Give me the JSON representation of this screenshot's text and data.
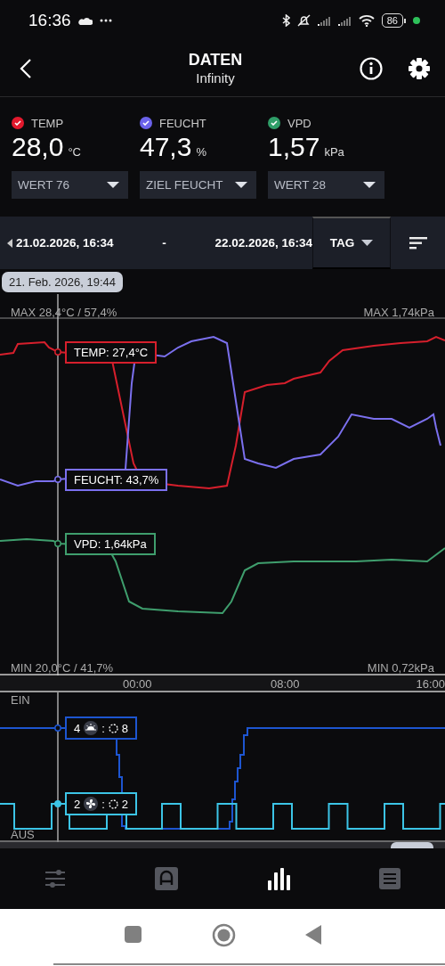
{
  "status_bar": {
    "time": "16:36",
    "battery": "86"
  },
  "header": {
    "title": "DATEN",
    "subtitle": "Infinity"
  },
  "sensors": [
    {
      "label": "TEMP",
      "value": "28,0",
      "unit": "°C",
      "color": "#e3192d",
      "checked": true,
      "dropdown": "WERT 76"
    },
    {
      "label": "FEUCHT",
      "value": "47,3",
      "unit": "%",
      "color": "#6b62ea",
      "checked": true,
      "dropdown": "ZIEL FEUCHT"
    },
    {
      "label": "VPD",
      "value": "1,57",
      "unit": "kPa",
      "color": "#2f9e68",
      "checked": true,
      "dropdown": "WERT 28"
    }
  ],
  "date_range": {
    "start": "21.02.2026, 16:34",
    "separator": "-",
    "end": "22.02.2026, 16:34",
    "period": "TAG"
  },
  "cursor": {
    "time": "21. Feb. 2026, 19:44"
  },
  "chart": {
    "max_left": "MAX 28,4°C / 57,4%",
    "max_right": "MAX 1,74kPa",
    "min_left": "MIN 20,0°C / 41,7%",
    "min_right": "MIN 0,72kPa",
    "series": [
      {
        "kind": "temp",
        "label": "TEMP: 27,4°C",
        "color": "#d61f2c"
      },
      {
        "kind": "humidity",
        "label": "FEUCHT: 43,7%",
        "color": "#7b70ee"
      },
      {
        "kind": "vpd",
        "label": "VPD: 1,64kPa",
        "color": "#3f9e6d"
      }
    ],
    "x_ticks": [
      "00:00",
      "08:00",
      "16:00"
    ]
  },
  "devices_chart": {
    "on_label": "EIN",
    "off_label": "AUS",
    "devices": [
      {
        "kind": "light",
        "count": "4",
        "separator": ":",
        "value": "8",
        "color": "#1d55d0"
      },
      {
        "kind": "fan",
        "count": "2",
        "separator": ":",
        "value": "2",
        "color": "#3cc4e6"
      }
    ]
  },
  "nav": [
    {
      "kind": "sliders",
      "selected": false
    },
    {
      "kind": "a-box",
      "selected": false
    },
    {
      "kind": "bars",
      "selected": true
    },
    {
      "kind": "list",
      "selected": false
    }
  ]
}
